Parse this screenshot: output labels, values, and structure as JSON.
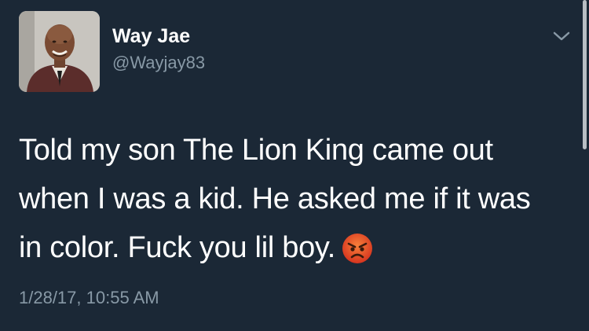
{
  "user": {
    "display_name": "Way Jae",
    "handle": "@Wayjay83",
    "avatar": "profile-photo"
  },
  "tweet": {
    "lines": [
      "Told my son The Lion King came out",
      "when I was a kid.  He asked me if it was",
      "in color.  Fuck you lil boy."
    ],
    "emoji": "angry-face-emoji",
    "timestamp": "1/28/17, 10:55 AM"
  },
  "icons": {
    "menu": "chevron-down-icon"
  },
  "colors": {
    "background": "#1b2836",
    "primary_text": "#ffffff",
    "secondary_text": "#8899a6",
    "emoji": "#e8452b"
  }
}
